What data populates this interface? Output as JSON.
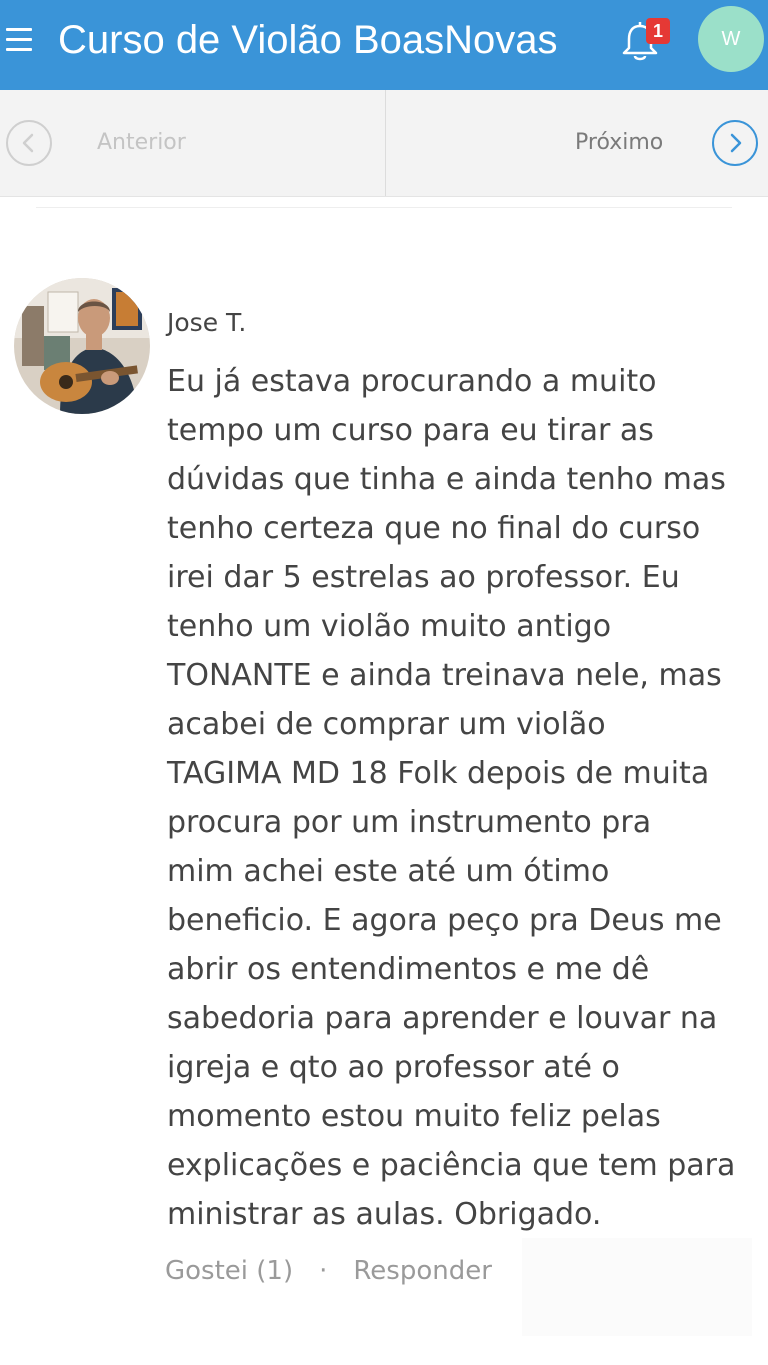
{
  "header": {
    "title": "Curso de Violão BoasNovas",
    "notification_count": "1",
    "user_initial": "W",
    "menu_icon": "hamburger-menu-icon",
    "bell_icon": "bell-icon",
    "colors": {
      "appbar": "#3a94d8",
      "badge": "#e53935",
      "avatar": "#9be0c9"
    }
  },
  "pager": {
    "previous_label": "Anterior",
    "next_label": "Próximo",
    "previous_icon": "chevron-left-icon",
    "next_icon": "chevron-right-icon"
  },
  "comment": {
    "author": "Jose T.",
    "lines": [
      "Eu já estava procurando a muito",
      "tempo um curso para eu tirar as",
      "dúvidas que tinha e ainda tenho mas",
      "tenho certeza que no final do curso",
      "irei dar 5 estrelas ao professor. Eu",
      "tenho um violão muito antigo",
      "TONANTE e ainda treinava nele, mas",
      "acabei de comprar um violão",
      "TAGIMA MD 18 Folk depois de muita",
      "procura por um instrumento pra",
      "mim achei este até um ótimo",
      "beneficio. E agora peço pra Deus me",
      "abrir os entendimentos e me dê",
      "sabedoria para aprender e louvar na",
      "igreja e qto ao professor até o",
      "momento estou muito feliz pelas",
      "explicações e paciência que tem para",
      "ministrar as aulas. Obrigado."
    ],
    "like_label": "Gostei (1)",
    "separator": "·",
    "reply_label": "Responder"
  }
}
